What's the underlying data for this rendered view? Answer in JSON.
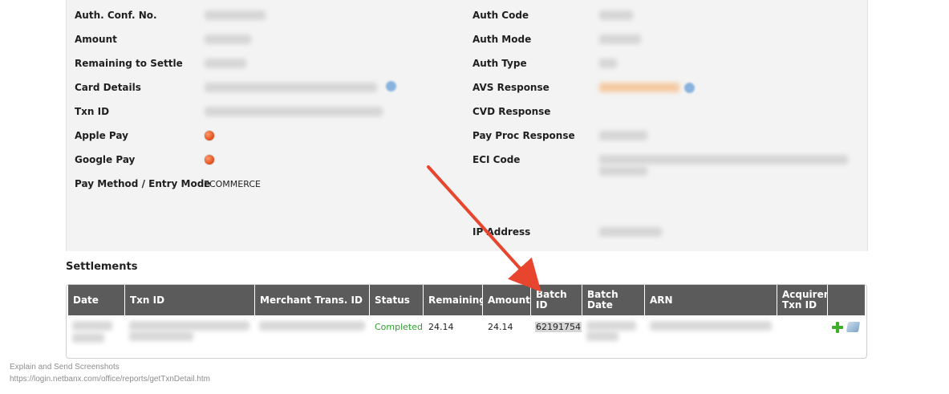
{
  "details": {
    "left": [
      {
        "label": "Auth. Conf. No."
      },
      {
        "label": "Amount"
      },
      {
        "label": "Remaining to Settle"
      },
      {
        "label": "Card Details"
      },
      {
        "label": "Txn ID"
      },
      {
        "label": "Apple Pay"
      },
      {
        "label": "Google Pay"
      },
      {
        "label": "Pay Method / Entry Mode",
        "value": "ECOMMERCE"
      }
    ],
    "right": [
      {
        "label": "Auth Code"
      },
      {
        "label": "Auth Mode"
      },
      {
        "label": "Auth Type"
      },
      {
        "label": "AVS Response"
      },
      {
        "label": "CVD Response"
      },
      {
        "label": "Pay Proc Response"
      },
      {
        "label": "ECI Code"
      },
      {
        "label": "IP Address"
      }
    ]
  },
  "settlements": {
    "title": "Settlements",
    "columns": [
      "Date",
      "Txn ID",
      "Merchant Trans. ID",
      "Status",
      "Remaining",
      "Amount",
      "Batch ID",
      "Batch Date",
      "ARN",
      "Acquirer Txn ID",
      ""
    ],
    "rows": [
      {
        "status": "Completed",
        "remaining": "24.14",
        "amount": "24.14",
        "batch_id": "62191754"
      }
    ]
  },
  "footer": {
    "line1": "Explain and Send Screenshots",
    "line2": "https://login.netbanx.com/office/reports/getTxnDetail.htm"
  },
  "colors": {
    "header_bg": "#5b5b5b",
    "status_completed": "#2f9e2f",
    "annotation_arrow": "#e8452f"
  },
  "icons": [
    "status-dot-icon",
    "info-icon",
    "add-icon",
    "document-icon"
  ]
}
